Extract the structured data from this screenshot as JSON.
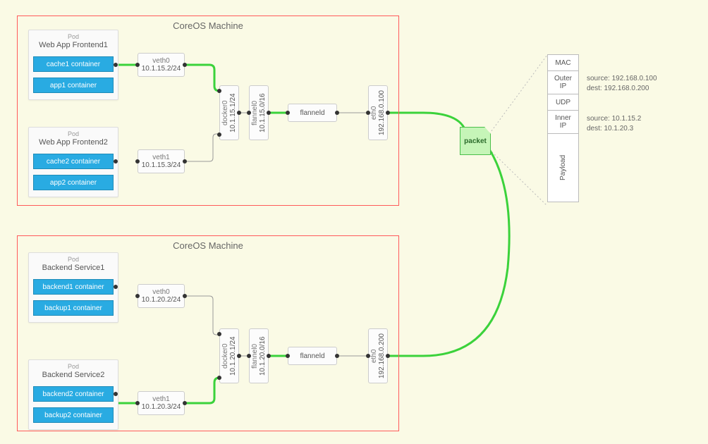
{
  "machines": [
    {
      "title": "CoreOS Machine",
      "pods": [
        {
          "sub": "Pod",
          "title": "Web App Frontend1",
          "containers": [
            "cache1 container",
            "app1 container"
          ],
          "veth": {
            "label": "veth0",
            "ip": "10.1.15.2/24"
          }
        },
        {
          "sub": "Pod",
          "title": "Web App Frontend2",
          "containers": [
            "cache2 container",
            "app2 container"
          ],
          "veth": {
            "label": "veth1",
            "ip": "10.1.15.3/24"
          }
        }
      ],
      "docker": {
        "label": "docker0",
        "ip": "10.1.15.1/24"
      },
      "flannel": {
        "label": "flannel0",
        "ip": "10.1.15.0/16"
      },
      "flanneld": "flanneld",
      "eth": {
        "label": "eth0",
        "ip": "192.168.0.100"
      }
    },
    {
      "title": "CoreOS Machine",
      "pods": [
        {
          "sub": "Pod",
          "title": "Backend Service1",
          "containers": [
            "backend1 container",
            "backup1 container"
          ],
          "veth": {
            "label": "veth0",
            "ip": "10.1.20.2/24"
          }
        },
        {
          "sub": "Pod",
          "title": "Backend Service2",
          "containers": [
            "backend2 container",
            "backup2 container"
          ],
          "veth": {
            "label": "veth1",
            "ip": "10.1.20.3/24"
          }
        }
      ],
      "docker": {
        "label": "docker0",
        "ip": "10.1.20.1/24"
      },
      "flannel": {
        "label": "flannel0",
        "ip": "10.1.20.0/16"
      },
      "flanneld": "flanneld",
      "eth": {
        "label": "eth0",
        "ip": "192.168.0.200"
      }
    }
  ],
  "packet_label": "packet",
  "packet_table": {
    "mac": "MAC",
    "outer": "Outer\nIP",
    "udp": "UDP",
    "inner": "Inner\nIP",
    "payload": "Payload"
  },
  "outer_annot": {
    "source": "source: 192.168.0.100",
    "dest": "dest: 192.168.0.200"
  },
  "inner_annot": {
    "source": "source: 10.1.15.2",
    "dest": "dest: 10.1.20.3"
  }
}
